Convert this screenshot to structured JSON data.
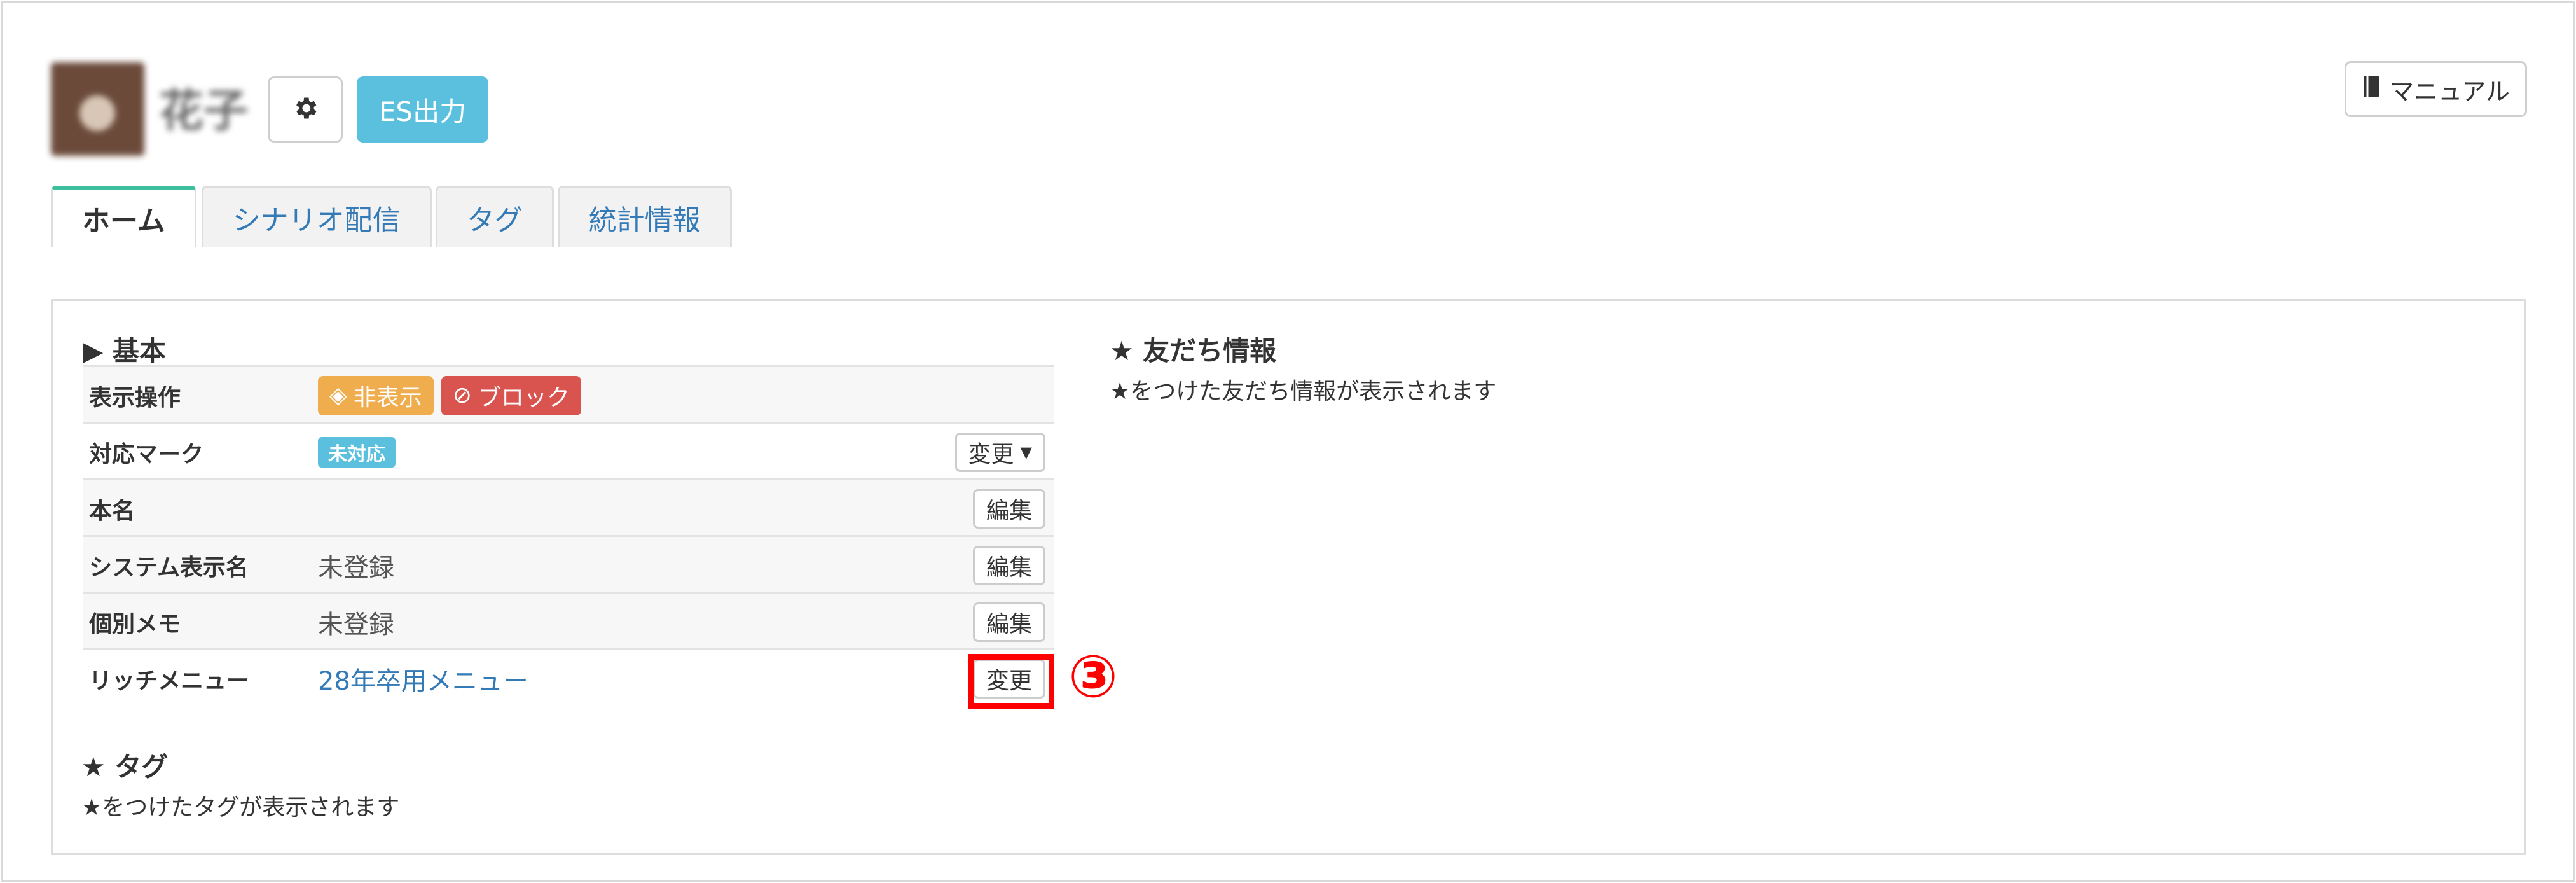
{
  "header": {
    "username": "花子",
    "es_button": "ES出力",
    "manual_button": "マニュアル"
  },
  "tabs": [
    {
      "label": "ホーム",
      "active": true
    },
    {
      "label": "シナリオ配信",
      "active": false
    },
    {
      "label": "タグ",
      "active": false
    },
    {
      "label": "統計情報",
      "active": false
    }
  ],
  "basic": {
    "title": "▶ 基本",
    "rows": {
      "display": {
        "label": "表示操作",
        "hide_badge": "非表示",
        "block_badge": "ブロック"
      },
      "mark": {
        "label": "対応マーク",
        "badge": "未対応",
        "button": "変更"
      },
      "real_name": {
        "label": "本名",
        "value": "",
        "button": "編集"
      },
      "system_name": {
        "label": "システム表示名",
        "value": "未登録",
        "button": "編集"
      },
      "memo": {
        "label": "個別メモ",
        "value": "未登録",
        "button": "編集"
      },
      "rich_menu": {
        "label": "リッチメニュー",
        "value": "28年卒用メニュー",
        "button": "変更"
      }
    }
  },
  "tag_section": {
    "title": "★ タグ",
    "subtitle": "★をつけたタグが表示されます"
  },
  "friend_section": {
    "title": "★ 友だち情報",
    "subtitle": "★をつけた友だち情報が表示されます"
  },
  "annotation": {
    "step": "③",
    "color": "#ff0000"
  },
  "colors": {
    "accent_tab": "#3cbf9d",
    "info": "#5bc0de",
    "warning": "#f0ad4e",
    "danger": "#d9534f",
    "link": "#337ab7"
  }
}
